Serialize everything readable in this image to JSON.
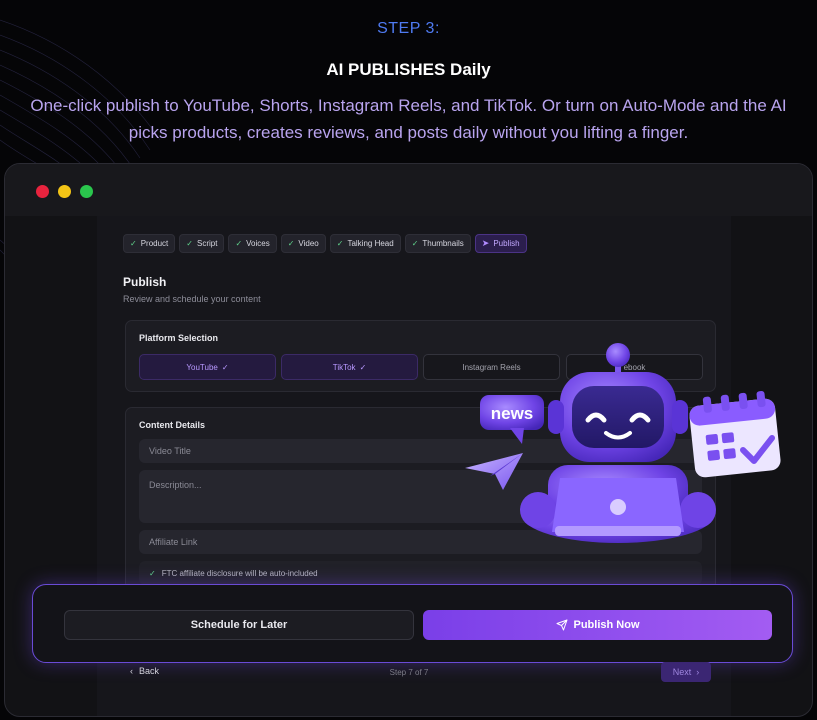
{
  "hero": {
    "step_label": "STEP 3:",
    "headline": "AI PUBLISHES Daily",
    "description": "One-click publish to YouTube, Shorts, Instagram Reels, and TikTok. Or turn on Auto-Mode and the AI picks products, creates reviews, and posts daily without you lifting a finger."
  },
  "window": {
    "controls": [
      "close",
      "minimize",
      "maximize"
    ]
  },
  "wizard": {
    "steps": [
      {
        "label": "Product",
        "icon": "check-icon",
        "state": "done"
      },
      {
        "label": "Script",
        "icon": "check-icon",
        "state": "done"
      },
      {
        "label": "Voices",
        "icon": "check-icon",
        "state": "done"
      },
      {
        "label": "Video",
        "icon": "check-icon",
        "state": "done"
      },
      {
        "label": "Talking Head",
        "icon": "check-icon",
        "state": "done"
      },
      {
        "label": "Thumbnails",
        "icon": "check-icon",
        "state": "done"
      },
      {
        "label": "Publish",
        "icon": "send-icon",
        "state": "active"
      }
    ],
    "check_glyph": "✓",
    "send_glyph": "➤"
  },
  "publish": {
    "title": "Publish",
    "subtitle": "Review and schedule your content"
  },
  "platform_selection": {
    "title": "Platform Selection",
    "platforms": [
      {
        "label": "YouTube",
        "selected": true
      },
      {
        "label": "TikTok",
        "selected": true
      },
      {
        "label": "Instagram Reels",
        "selected": false
      },
      {
        "label": "Facebook",
        "selected": false
      }
    ],
    "visible_facebook_text": "ebook"
  },
  "content_details": {
    "title": "Content Details",
    "video_title_placeholder": "Video Title",
    "description_placeholder": "Description...",
    "affiliate_placeholder": "Affiliate Link",
    "ftc_note": "FTC affiliate disclosure will be auto-included"
  },
  "actions": {
    "schedule_label": "Schedule for Later",
    "publish_label": "Publish Now"
  },
  "footer": {
    "back_label": "Back",
    "step_indicator": "Step 7 of 7",
    "next_label": "Next"
  },
  "mascot": {
    "news_badge": "news",
    "icons": [
      "robot-icon",
      "paper-plane-icon",
      "calendar-icon",
      "laptop-icon"
    ]
  },
  "colors": {
    "accent_purple": "#8b4cf0",
    "step_blue": "#4f7bf2",
    "subtext_lavender": "#b9a4ef",
    "check_green": "#5fd08a"
  }
}
